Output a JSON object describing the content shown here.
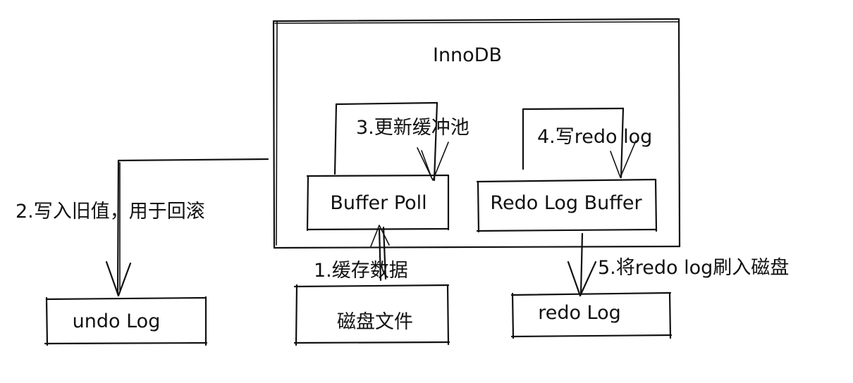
{
  "diagram": {
    "container": {
      "title": "InnoDB"
    },
    "nodes": {
      "buffer_pool": "Buffer Poll",
      "redo_log_buffer": "Redo Log Buffer",
      "undo_log": "undo Log",
      "disk_file": "磁盘文件",
      "redo_log": "redo Log"
    },
    "steps": {
      "step1": "1.缓存数据",
      "step2": "2.写入旧值，用于回滚",
      "step3": "3.更新缓冲池",
      "step4": "4.写redo log",
      "step5": "5.将redo log刷入磁盘"
    }
  }
}
